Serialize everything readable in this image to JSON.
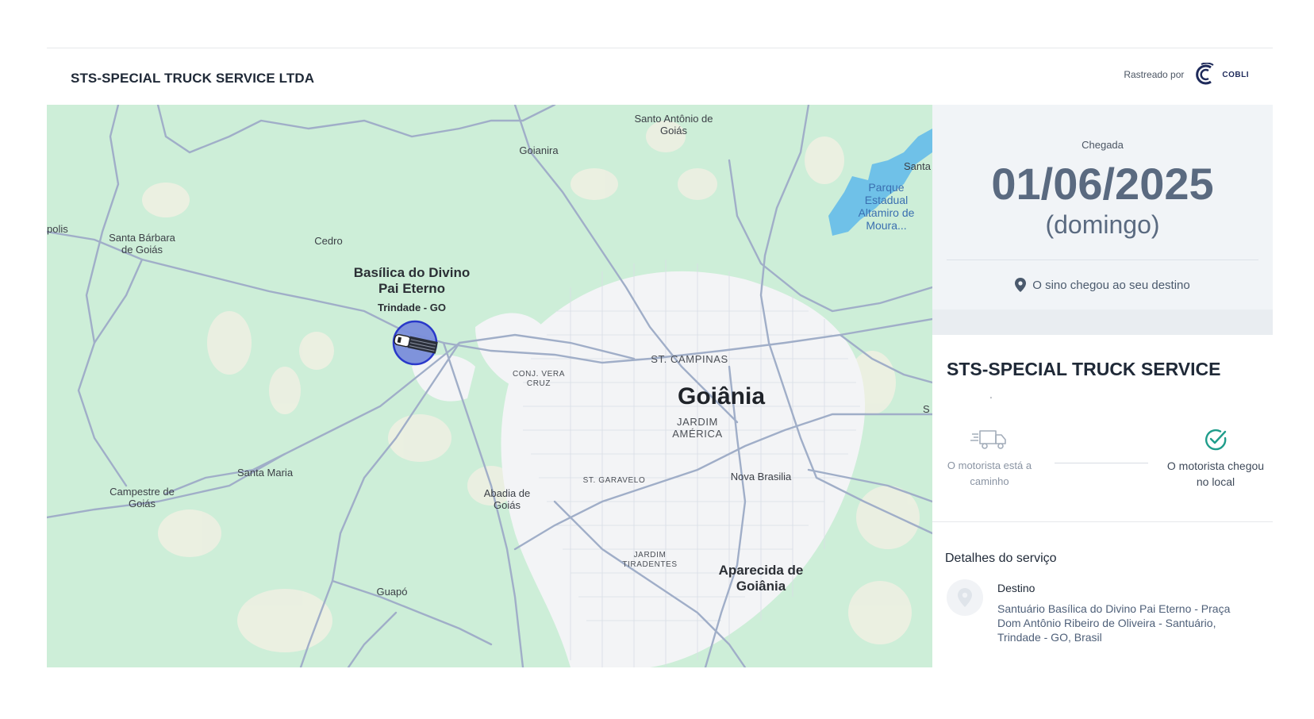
{
  "header": {
    "company_name": "STS-SPECIAL TRUCK SERVICE LTDA",
    "tracked_by_label": "Rastreado por",
    "brand_name": "COBLI"
  },
  "map": {
    "labels": {
      "santo_antonio": "Santo Antônio de Goiás",
      "goianira": "Goianira",
      "santa": "Santa",
      "parque": "Parque Estadual Altamiro de Moura...",
      "polis": "polis",
      "santa_barbara": "Santa Bárbara de Goiás",
      "cedro": "Cedro",
      "basilica": "Basílica do Divino Pai Eterno",
      "trindade": "Trindade - GO",
      "st_campinas": "ST. CAMPINAS",
      "conj_vera_cruz": "CONJ. VERA CRUZ",
      "goiania": "Goiânia",
      "jardim_america": "JARDIM AMÉRICA",
      "santa_maria": "Santa Maria",
      "campestre": "Campestre de Goiás",
      "abadia": "Abadia de Goiás",
      "st_garavelo": "ST. GARAVELO",
      "nova_brasilia": "Nova Brasilia",
      "jardim_tiradentes": "JARDIM TIRADENTES",
      "aparecida": "Aparecida de Goiânia",
      "guapo": "Guapó",
      "s_edge": "S"
    },
    "colors": {
      "land": "#cdeed8",
      "city": "#f3f4f6",
      "road": "#a0aec8",
      "water": "#6fc1e8",
      "marker": "#7b8fdc"
    }
  },
  "arrival": {
    "label": "Chegada",
    "date": "01/06/2025",
    "weekday": "(domingo)",
    "status": "O sino chegou ao seu destino"
  },
  "service": {
    "title": "STS-SPECIAL TRUCK SERVICE",
    "dot": "'",
    "steps": [
      {
        "label": "O motorista está a caminho",
        "icon": "truck-icon"
      },
      {
        "label": "O motorista chegou no local",
        "icon": "check-circle-icon"
      }
    ]
  },
  "details": {
    "title": "Detalhes do serviço",
    "destination_label": "Destino",
    "destination_address": "Santuário Basílica do Divino Pai Eterno - Praça Dom Antônio Ribeiro de Oliveira - Santuário, Trindade - GO, Brasil"
  }
}
